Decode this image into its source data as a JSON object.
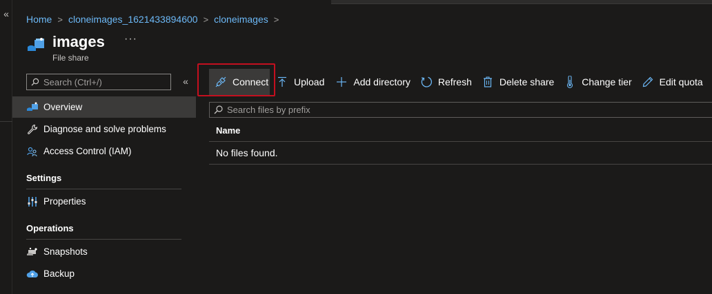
{
  "breadcrumb": {
    "items": [
      "Home",
      "cloneimages_1621433894600",
      "cloneimages"
    ],
    "separator": ">"
  },
  "header": {
    "title": "images",
    "subtitle": "File share",
    "more": "···"
  },
  "sidebar": {
    "search_placeholder": "Search (Ctrl+/)",
    "collapse": "«",
    "items": [
      {
        "label": "Overview",
        "icon": "file-share-icon",
        "active": true
      },
      {
        "label": "Diagnose and solve problems",
        "icon": "wrench-icon"
      },
      {
        "label": "Access Control (IAM)",
        "icon": "people-icon"
      }
    ],
    "sections": [
      {
        "title": "Settings",
        "items": [
          {
            "label": "Properties",
            "icon": "sliders-icon"
          }
        ]
      },
      {
        "title": "Operations",
        "items": [
          {
            "label": "Snapshots",
            "icon": "snapshot-icon"
          },
          {
            "label": "Backup",
            "icon": "backup-cloud-icon"
          }
        ]
      }
    ]
  },
  "rail": {
    "collapse": "«"
  },
  "toolbar": {
    "connect": "Connect",
    "upload": "Upload",
    "add_directory": "Add directory",
    "refresh": "Refresh",
    "delete_share": "Delete share",
    "change_tier": "Change tier",
    "edit_quota": "Edit quota"
  },
  "files": {
    "search_placeholder": "Search files by prefix",
    "column_name": "Name",
    "empty_message": "No files found."
  },
  "colors": {
    "background": "#1b1a19",
    "link": "#6cb8f6",
    "active_row": "#3b3a39",
    "highlight_border": "#c50f1f",
    "accent_blue": "#50a0e6"
  }
}
